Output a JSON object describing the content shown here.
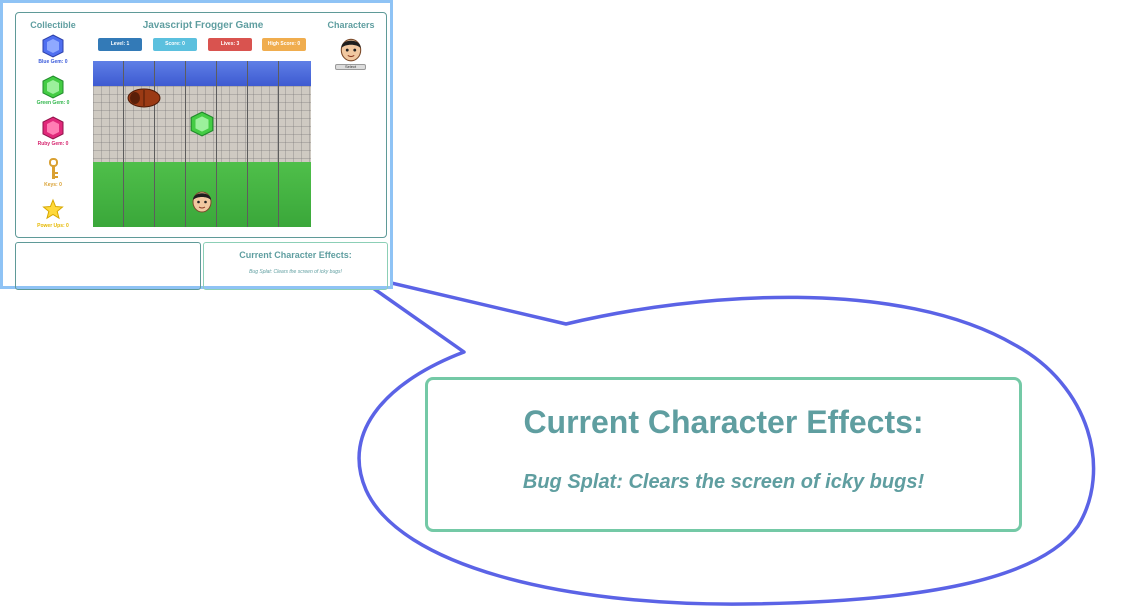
{
  "game": {
    "title": "Javascript Frogger Game",
    "collectible_title": "Collectible",
    "characters_title": "Characters",
    "collectibles": [
      {
        "label": "Blue Gem: 0",
        "icon": "blue-gem-icon",
        "color": "#3b5bdb"
      },
      {
        "label": "Green Gem: 0",
        "icon": "green-gem-icon",
        "color": "#2fb64a"
      },
      {
        "label": "Ruby Gem: 0",
        "icon": "ruby-gem-icon",
        "color": "#d6246e"
      },
      {
        "label": "Keys: 0",
        "icon": "key-icon",
        "color": "#d9a032"
      },
      {
        "label": "Power Ups: 0",
        "icon": "star-icon",
        "color": "#e6b800"
      }
    ],
    "stats": [
      {
        "label": "Level: 1",
        "color": "#337ab7"
      },
      {
        "label": "Score: 0",
        "color": "#5bc0de"
      },
      {
        "label": "Lives: 3",
        "color": "#d9534f"
      },
      {
        "label": "High Score: 0",
        "color": "#f0ad4e"
      }
    ],
    "select_label": "Select"
  },
  "effects": {
    "title": "Current Character Effects:",
    "description": "Bug Splat: Clears the screen of icky bugs!"
  },
  "colors": {
    "callout_stroke": "#5b63e6",
    "frame_border": "#8fc3f5",
    "accent_text": "#5f9ea0"
  }
}
